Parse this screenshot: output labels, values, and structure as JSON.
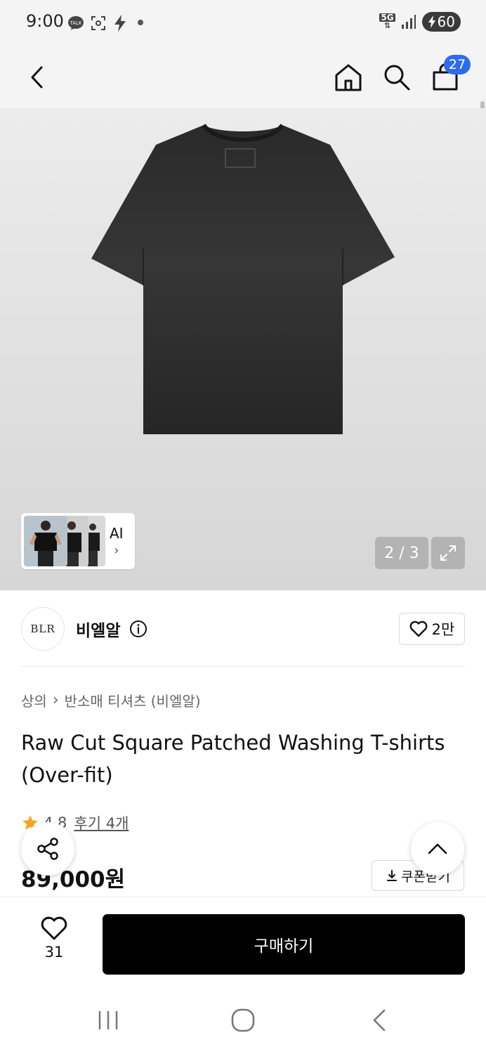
{
  "status_bar": {
    "time": "9:00",
    "network": "5G",
    "battery": "60"
  },
  "header": {
    "cart_count": "27"
  },
  "gallery": {
    "ai_label": "AI",
    "page_indicator": "2 / 3"
  },
  "brand": {
    "logo_text": "BLR",
    "name": "비엘알",
    "favorite_count": "2만"
  },
  "product": {
    "breadcrumb": [
      "상의",
      "반소매 티셔츠 (비엘알)"
    ],
    "title": "Raw Cut Square Patched Washing T-shirts (Over-fit)",
    "rating": "4.8",
    "review_link": "후기 4개",
    "price": "89,000원",
    "coupon_label": "쿠폰받기"
  },
  "bottom_bar": {
    "like_count": "31",
    "buy_label": "구매하기"
  },
  "colors": {
    "accent": "#2f6bed",
    "star": "#f5a623",
    "buy_button": "#000000"
  },
  "icons": {
    "back": "chevron-left-icon",
    "home": "home-icon",
    "search": "search-icon",
    "cart": "shopping-bag-icon",
    "share": "share-icon",
    "scroll_top": "chevron-up-icon"
  }
}
